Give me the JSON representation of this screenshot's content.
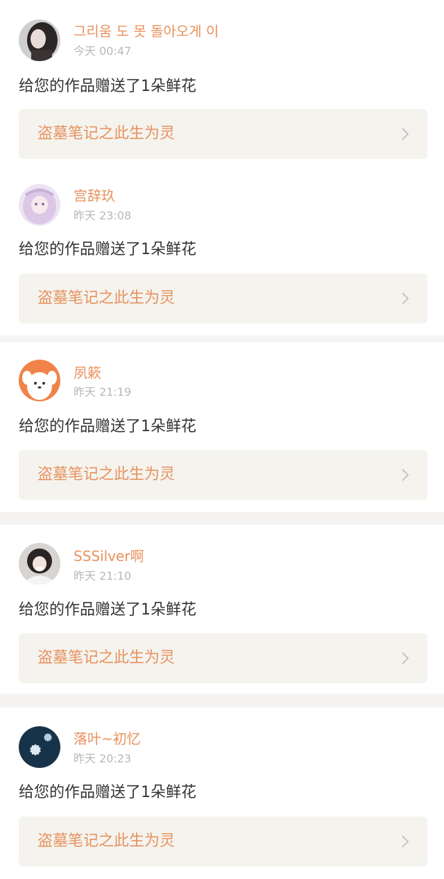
{
  "notifications": [
    {
      "user": "그리움 도 못 돌아오게 이",
      "time": "今天 00:47",
      "message": "给您的作品赠送了1朵鲜花",
      "work_title": "盗墓笔记之此生为灵",
      "avatar_icon": "avatar-girl-dark-hair"
    },
    {
      "user": "宫辞玖",
      "time": "昨天 23:08",
      "message": "给您的作品赠送了1朵鲜花",
      "work_title": "盗墓笔记之此生为灵",
      "avatar_icon": "avatar-anime-girl-pink"
    },
    {
      "user": "夙簌",
      "time": "昨天 21:19",
      "message": "给您的作品赠送了1朵鲜花",
      "work_title": "盗墓笔记之此生为灵",
      "avatar_icon": "avatar-cartoon-dog-orange"
    },
    {
      "user": "SSSilver啊",
      "time": "昨天 21:10",
      "message": "给您的作品赠送了1朵鲜花",
      "work_title": "盗墓笔记之此生为灵",
      "avatar_icon": "avatar-girl-white-hoodie"
    },
    {
      "user": "落叶~初忆",
      "time": "昨天 20:23",
      "message": "给您的作品赠送了1朵鲜花",
      "work_title": "盗墓笔记之此生为灵",
      "avatar_icon": "avatar-blue-flowers"
    }
  ],
  "colors": {
    "accent": "#e9915c",
    "link_background": "#f5f3ee",
    "separator": "#f6f4f3",
    "time_text": "#b8b8b8",
    "message_text": "#333333"
  },
  "icons": {
    "chevron": "chevron-right-icon"
  }
}
